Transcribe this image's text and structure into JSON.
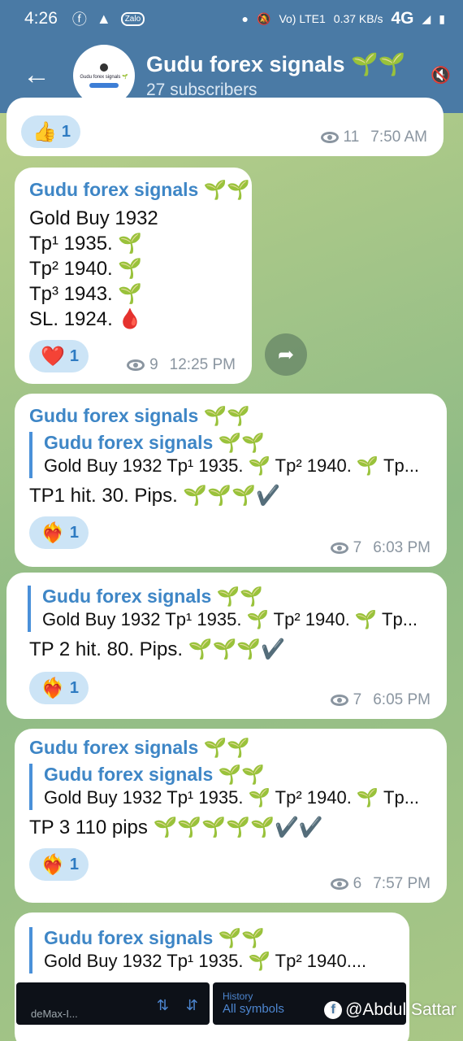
{
  "status_bar": {
    "time": "4:26",
    "icons": [
      "facebook-icon",
      "alert-icon",
      "zalo-icon"
    ],
    "zalo": "Zalo",
    "lte": "Vo) LTE1",
    "speed": "0.37 KB/s",
    "network": "4G"
  },
  "header": {
    "title": "Gudu forex signals 🌱🌱",
    "subtitle": "27 subscribers",
    "avatar_text": "Gudu forex signals 🌱"
  },
  "messages": [
    {
      "reaction_emoji": "👍",
      "reaction_count": "1",
      "views": "11",
      "time": "7:50 AM"
    },
    {
      "channel": "Gudu forex signals 🌱🌱",
      "lines": [
        "Gold Buy 1932",
        "Tp¹ 1935. 🌱",
        "Tp² 1940. 🌱",
        "Tp³ 1943. 🌱",
        "SL. 1924. 🩸"
      ],
      "reaction_emoji": "❤️",
      "reaction_count": "1",
      "views": "9",
      "time": "12:25 PM"
    },
    {
      "channel": "Gudu forex signals 🌱🌱",
      "quote_name": "Gudu forex signals 🌱🌱",
      "quote_text": "Gold Buy 1932 Tp¹ 1935. 🌱 Tp² 1940. 🌱 Tp...",
      "text": "TP1 hit.  30. Pips. 🌱🌱🌱✔️",
      "reaction_emoji": "❤️‍🔥",
      "reaction_count": "1",
      "views": "7",
      "time": "6:03 PM"
    },
    {
      "quote_name": "Gudu forex signals 🌱🌱",
      "quote_text": "Gold Buy 1932 Tp¹ 1935. 🌱 Tp² 1940. 🌱 Tp...",
      "text": "TP 2 hit.  80. Pips. 🌱🌱🌱✔️",
      "reaction_emoji": "❤️‍🔥",
      "reaction_count": "1",
      "views": "7",
      "time": "6:05 PM"
    },
    {
      "channel": "Gudu forex signals 🌱🌱",
      "quote_name": "Gudu forex signals 🌱🌱",
      "quote_text": "Gold Buy 1932 Tp¹ 1935. 🌱 Tp² 1940. 🌱 Tp...",
      "text": "TP 3 110 pips  🌱🌱🌱🌱🌱✔️✔️",
      "reaction_emoji": "❤️‍🔥",
      "reaction_count": "1",
      "views": "6",
      "time": "7:57 PM"
    },
    {
      "quote_name": "Gudu forex signals 🌱🌱",
      "quote_text": "Gold Buy 1932 Tp¹ 1935. 🌱 Tp² 1940...."
    }
  ],
  "preview": {
    "left_label": "deMax-I...",
    "right_top": "History",
    "right_bottom": "All symbols"
  },
  "credit": "@Abdul Sattar",
  "colors": {
    "header": "#4a7aa5",
    "channel_name": "#3e86c6",
    "reaction_bg": "#cce4f6"
  }
}
